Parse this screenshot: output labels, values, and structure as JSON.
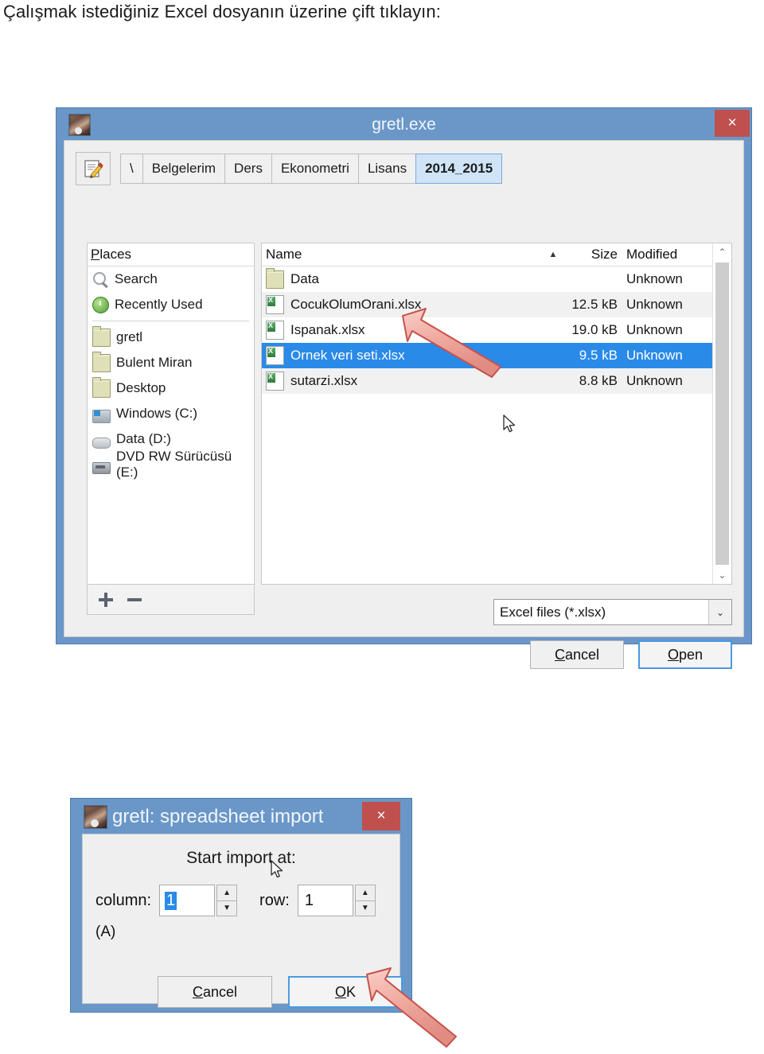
{
  "page": {
    "heading": "Çalışmak istediğiniz Excel dosyanın üzerine çift tıklayın:"
  },
  "file_dialog": {
    "title": "gretl.exe",
    "close_label": "×",
    "app_icon": "gretl-app-icon",
    "toolbar": {
      "edit_icon": "edit-pencil-icon",
      "breadcrumbs": [
        {
          "label": "\\",
          "active": false
        },
        {
          "label": "Belgelerim",
          "active": false
        },
        {
          "label": "Ders",
          "active": false
        },
        {
          "label": "Ekonometri",
          "active": false
        },
        {
          "label": "Lisans",
          "active": false
        },
        {
          "label": "2014_2015",
          "active": true
        }
      ]
    },
    "places": {
      "header": "Places",
      "header_accel": "P",
      "items": [
        {
          "label": "Search",
          "icon": "search-icon"
        },
        {
          "label": "Recently Used",
          "icon": "recent-icon"
        },
        {
          "label": "gretl",
          "icon": "folder-icon"
        },
        {
          "label": "Bulent Miran",
          "icon": "folder-icon"
        },
        {
          "label": "Desktop",
          "icon": "folder-icon"
        },
        {
          "label": "Windows (C:)",
          "icon": "windows-drive-icon"
        },
        {
          "label": "Data (D:)",
          "icon": "disk-drive-icon"
        },
        {
          "label": "DVD RW Sürücüsü (E:)",
          "icon": "dvd-drive-icon"
        }
      ],
      "add_label": "add-place-button",
      "remove_label": "remove-place-button"
    },
    "file_list": {
      "columns": [
        "Name",
        "Size",
        "Modified"
      ],
      "sort_indicator": "▲",
      "rows": [
        {
          "name": "Data",
          "size": "",
          "modified": "Unknown",
          "icon": "folder-icon",
          "selected": false
        },
        {
          "name": "CocukOlumOrani.xlsx",
          "size": "12.5 kB",
          "modified": "Unknown",
          "icon": "excel-file-icon",
          "selected": false
        },
        {
          "name": "Ispanak.xlsx",
          "size": "19.0 kB",
          "modified": "Unknown",
          "icon": "excel-file-icon",
          "selected": false
        },
        {
          "name": "Ornek veri seti.xlsx",
          "size": "9.5 kB",
          "modified": "Unknown",
          "icon": "excel-file-icon",
          "selected": true
        },
        {
          "name": "sutarzi.xlsx",
          "size": "8.8 kB",
          "modified": "Unknown",
          "icon": "excel-file-icon",
          "selected": false
        }
      ],
      "scroll_up": "⌃",
      "scroll_down": "⌄"
    },
    "filter": {
      "selected": "Excel files (*.xlsx)",
      "arrow": "⌄"
    },
    "buttons": {
      "cancel": "Cancel",
      "cancel_accel": "C",
      "open": "Open",
      "open_accel": "O"
    }
  },
  "import_dialog": {
    "title": "gretl: spreadsheet import",
    "close_label": "×",
    "app_icon": "gretl-app-icon",
    "heading": "Start import at:",
    "column_label": "column:",
    "column_value": "1",
    "row_label": "row:",
    "row_value": "1",
    "cell_ref": "(A)",
    "spin_up": "▲",
    "spin_down": "▼",
    "buttons": {
      "cancel": "Cancel",
      "cancel_accel": "C",
      "ok": "OK",
      "ok_accel": "O"
    }
  },
  "colors": {
    "titlebar": "#6a97c8",
    "close_red": "#c0504d",
    "selection_blue": "#2a8ae8",
    "active_crumb": "#cfe4f7",
    "annotation_arrow": "#f0a9a0",
    "annotation_arrow_border": "#c8514a"
  }
}
